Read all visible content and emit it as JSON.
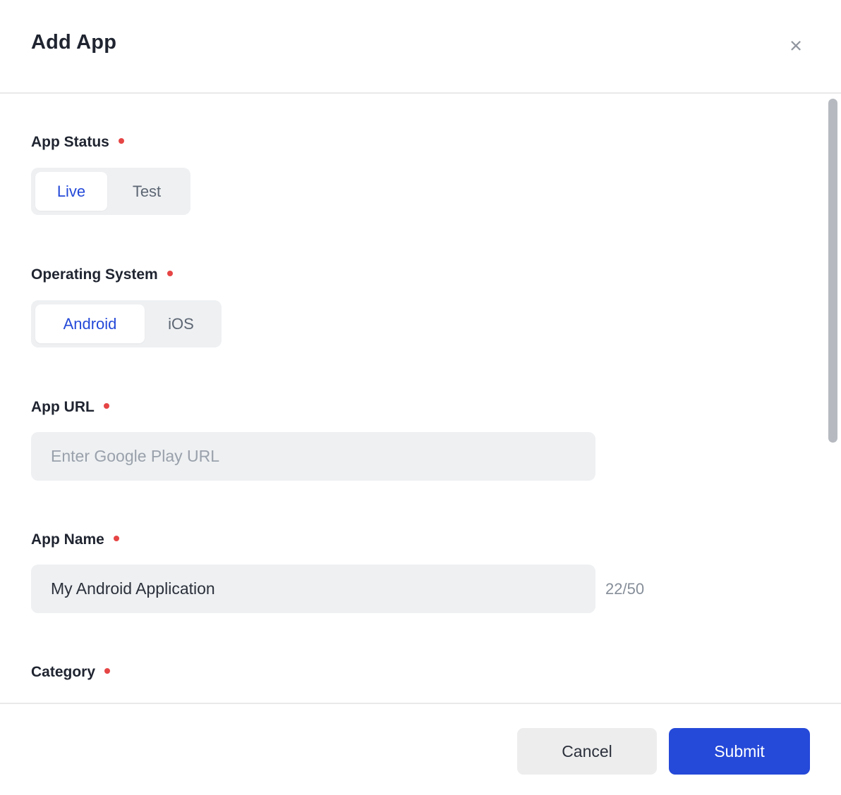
{
  "modal": {
    "title": "Add App",
    "close_icon": "×"
  },
  "form": {
    "app_status": {
      "label": "App Status",
      "required": true,
      "options": [
        {
          "label": "Live",
          "selected": true
        },
        {
          "label": "Test",
          "selected": false
        }
      ]
    },
    "operating_system": {
      "label": "Operating System",
      "required": true,
      "options": [
        {
          "label": "Android",
          "selected": true
        },
        {
          "label": "iOS",
          "selected": false
        }
      ]
    },
    "app_url": {
      "label": "App URL",
      "required": true,
      "placeholder": "Enter Google Play URL",
      "value": ""
    },
    "app_name": {
      "label": "App Name",
      "required": true,
      "value": "My Android Application",
      "counter": "22/50"
    },
    "category": {
      "label": "Category",
      "required": true
    }
  },
  "footer": {
    "cancel_label": "Cancel",
    "submit_label": "Submit"
  },
  "colors": {
    "accent_blue": "#2549d8",
    "selected_text_blue": "#2449d8",
    "required_dot_red": "#e64545",
    "field_bg": "#eef0f2",
    "label_text": "#1f2430",
    "muted_text": "#5d6673",
    "placeholder_text": "#9aa1ab",
    "counter_text": "#868e99",
    "divider": "#e9e9ea",
    "scrollbar": "#b6bac0"
  }
}
